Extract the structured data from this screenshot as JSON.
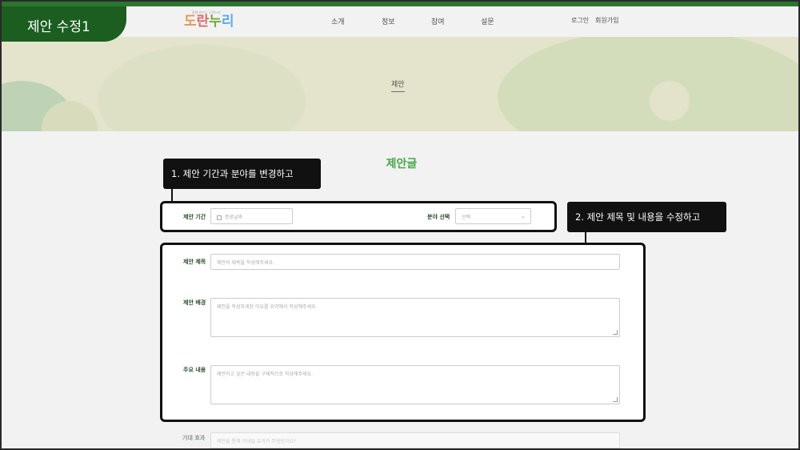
{
  "tag": "제안 수정1",
  "nav": {
    "logo": [
      "도",
      "란",
      "누",
      "리"
    ],
    "logo_sub": "함께 만드는 도란누리",
    "items": [
      "소개",
      "정보",
      "참여",
      "설문"
    ],
    "login": "로그인",
    "signup": "회원가입"
  },
  "hero": {
    "title": "제안"
  },
  "section": {
    "title": "제안글"
  },
  "callouts": {
    "one": "1. 제안 기간과 분야를 변경하고",
    "two": "2. 제안 제목 및 내용을 수정하고"
  },
  "form": {
    "period_label": "제안 기간",
    "period_placeholder": "종료날짜",
    "field_label": "분야 선택",
    "field_selected": "선택",
    "title_label": "제안 제목",
    "title_placeholder": "제안의 제목을 작성해주세요.",
    "background_label": "제안 배경",
    "background_placeholder": "제안을 작성하게된 이유를 요약해서 작성해주세요.",
    "content_label": "주요 내용",
    "content_placeholder": "제안하고 싶은 내용을 구체적으로 작성해주세요.",
    "effect_label": "기대 효과",
    "effect_placeholder": "제안을 통해 기대될 효과가 무엇인가요?"
  },
  "colors": {
    "accent": "#1b5e20",
    "brand_green": "#4caf50"
  }
}
